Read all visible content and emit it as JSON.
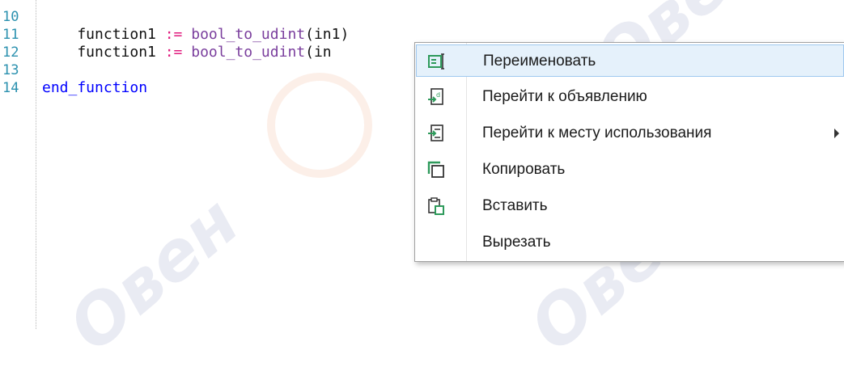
{
  "editor": {
    "lines": [
      {
        "number": "10",
        "code": []
      },
      {
        "number": "11",
        "code": [
          {
            "cls": "id",
            "text": "    function1 "
          },
          {
            "cls": "op",
            "text": ":= "
          },
          {
            "cls": "fn",
            "text": "bool_to_udint"
          },
          {
            "cls": "id",
            "text": "(in1)"
          }
        ]
      },
      {
        "number": "12",
        "code": [
          {
            "cls": "id",
            "text": "    function1 "
          },
          {
            "cls": "op",
            "text": ":= "
          },
          {
            "cls": "fn",
            "text": "bool_to_udint"
          },
          {
            "cls": "id",
            "text": "(in"
          }
        ]
      },
      {
        "number": "13",
        "code": []
      },
      {
        "number": "14",
        "code": [
          {
            "cls": "kw",
            "text": "end_function"
          }
        ]
      }
    ]
  },
  "context_menu": {
    "items": [
      {
        "label": "Переименовать",
        "icon": "rename-icon",
        "highlighted": true,
        "submenu": false
      },
      {
        "label": "Перейти к объявлению",
        "icon": "go-to-declaration-icon",
        "highlighted": false,
        "submenu": false
      },
      {
        "label": "Перейти к месту использования",
        "icon": "go-to-usage-icon",
        "highlighted": false,
        "submenu": true
      },
      {
        "label": "Копировать",
        "icon": "copy-icon",
        "highlighted": false,
        "submenu": false
      },
      {
        "label": "Вставить",
        "icon": "paste-icon",
        "highlighted": false,
        "submenu": false
      },
      {
        "label": "Вырезать",
        "icon": "",
        "highlighted": false,
        "submenu": false
      }
    ]
  },
  "colors": {
    "line_number": "#2b91af",
    "keyword": "#0000ff",
    "operator": "#e0197d",
    "function": "#7a3e9d",
    "menu_highlight": "#e5f1fb",
    "icon_green": "#2e9a5b"
  },
  "watermark": {
    "text": "Овен"
  }
}
